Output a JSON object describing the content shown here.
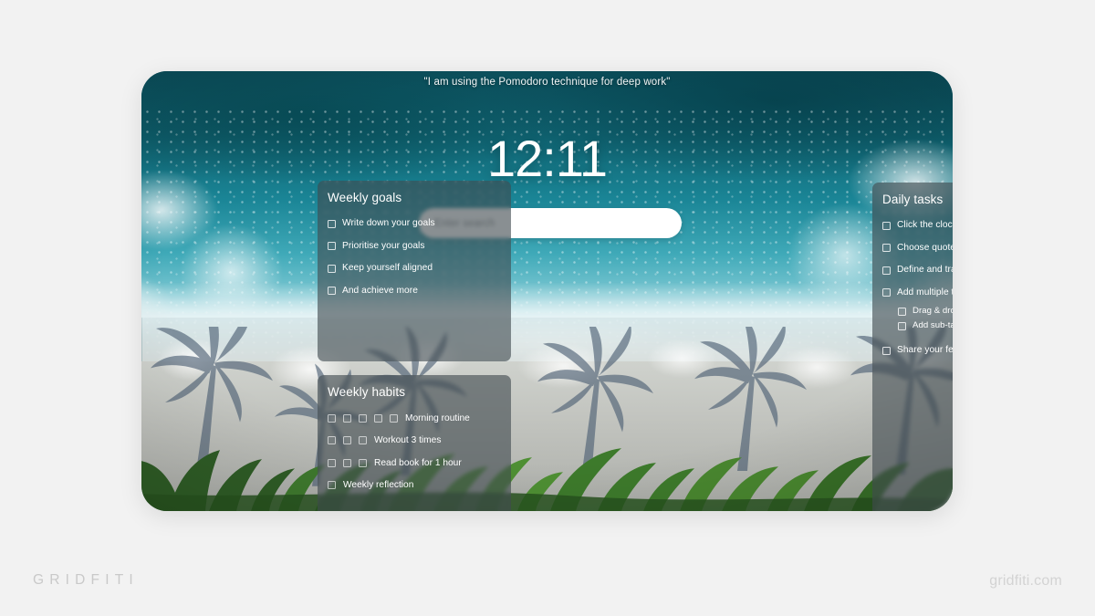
{
  "quote": "\"I am using the Pomodoro technique for deep work\"",
  "clock": "12:11",
  "search": {
    "placeholder": "Enter search"
  },
  "panels": {
    "weekly_goals": {
      "title": "Weekly goals",
      "items": [
        "Write down your goals",
        "Prioritise your goals",
        "Keep yourself aligned",
        "And achieve more"
      ]
    },
    "weekly_habits": {
      "title": "Weekly habits",
      "rows": [
        {
          "label": "Morning routine",
          "boxes": 5
        },
        {
          "label": "Workout 3 times",
          "boxes": 3
        },
        {
          "label": "Read book for 1 hour",
          "boxes": 3
        },
        {
          "label": "Weekly reflection",
          "boxes": 1
        }
      ]
    },
    "daily_tasks": {
      "title": "Daily tasks",
      "items": [
        {
          "label": "Click the clock to make it a Pomodoro timer",
          "level": 0
        },
        {
          "label": "Choose quotes for motivation and inspiration",
          "level": 0
        },
        {
          "label": "Define and track your habits",
          "level": 0
        },
        {
          "label": "Add multiple todo lists",
          "level": 0
        },
        {
          "label": "Drag & drop todo items between lists",
          "level": 1
        },
        {
          "label": "Add sub-tasks",
          "level": 1
        },
        {
          "label": "Share your feedback via the settings menu",
          "level": 0
        }
      ]
    }
  },
  "branding": {
    "left": "GRIDFITI",
    "right": "gridfiti.com"
  },
  "colors": {
    "page_background": "#f2f2f2",
    "panel_fill": "rgba(64,74,79,0.62)",
    "ocean_deep": "#0c4f5c",
    "ocean_mid": "#1a8596",
    "sand": "#c3c5c0",
    "search_bar": "#ffffff",
    "brand_text": "#c9c9c9"
  }
}
